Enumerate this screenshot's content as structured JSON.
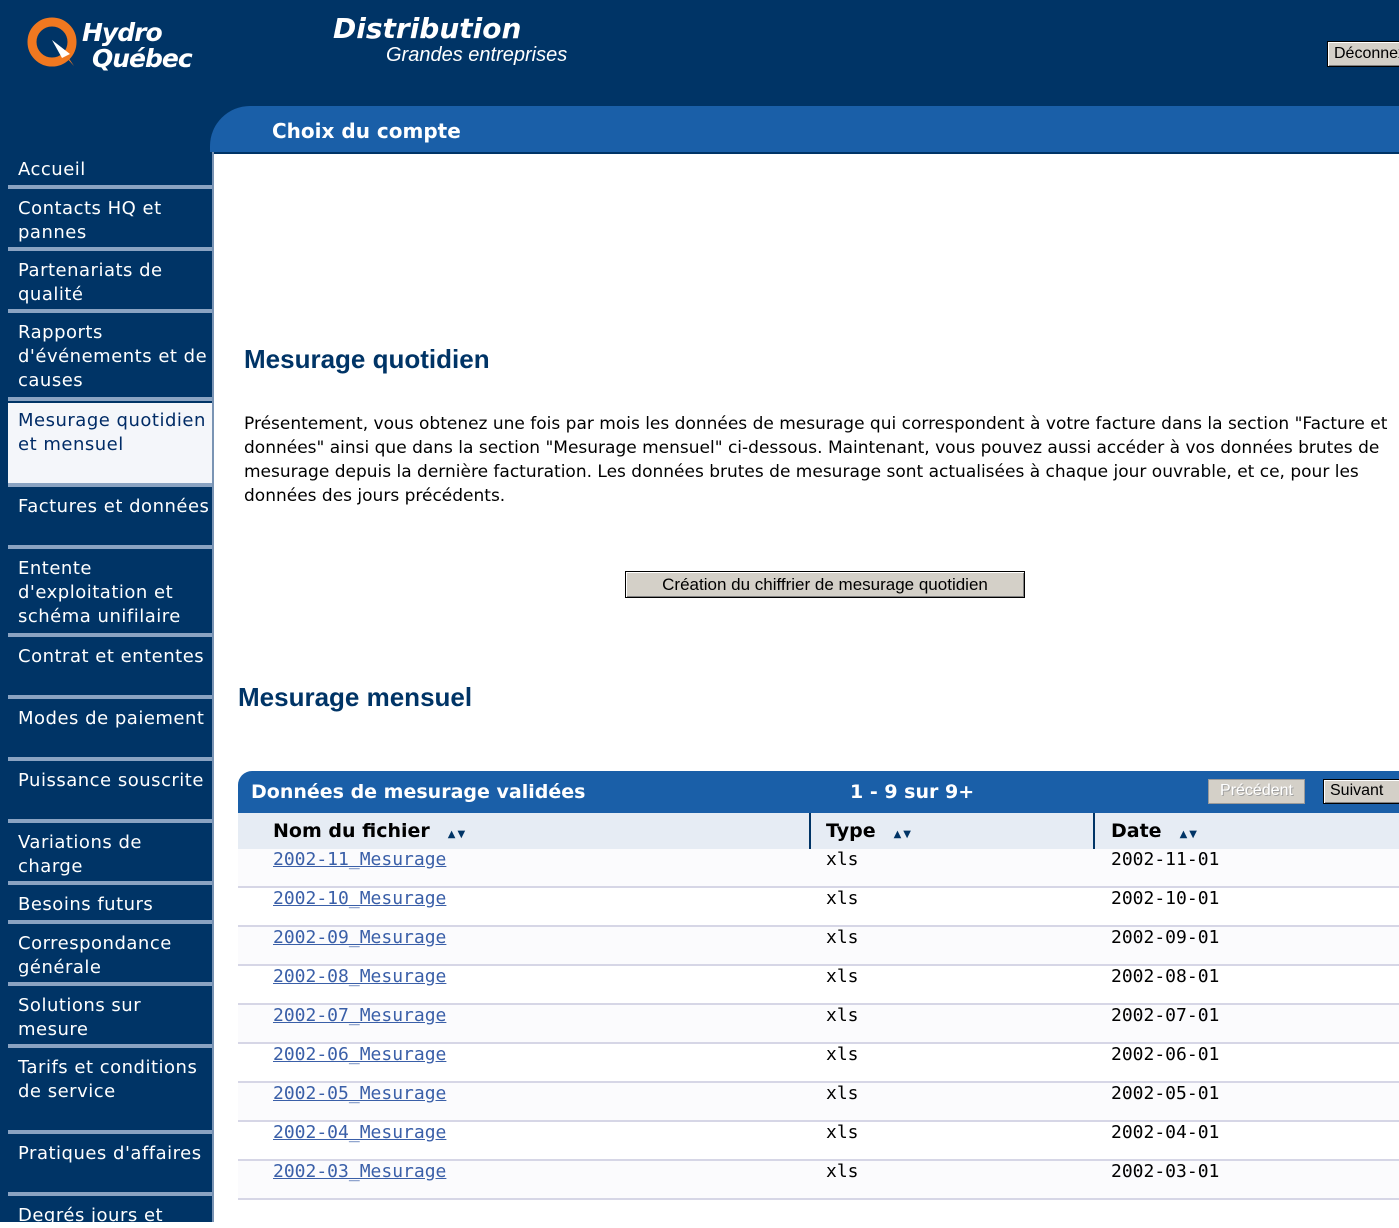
{
  "header": {
    "logo_line1": "Hydro",
    "logo_line2": "Québec",
    "title": "Distribution",
    "subtitle": "Grandes entreprises",
    "logout_label": "Déconnexion",
    "section_title": "Choix du compte"
  },
  "sidebar": {
    "items": [
      {
        "label": "Accueil"
      },
      {
        "label": "Contacts HQ et pannes"
      },
      {
        "label": "Partenariats de qualité"
      },
      {
        "label": "Rapports d'événements et de causes"
      },
      {
        "label": "Mesurage quotidien et mensuel",
        "active": true
      },
      {
        "label": "Factures et données"
      },
      {
        "label": "Entente d'exploitation et schéma unifilaire"
      },
      {
        "label": "Contrat et ententes"
      },
      {
        "label": "Modes de paiement"
      },
      {
        "label": "Puissance souscrite"
      },
      {
        "label": "Variations de charge"
      },
      {
        "label": "Besoins futurs"
      },
      {
        "label": "Correspondance générale"
      },
      {
        "label": "Solutions sur mesure"
      },
      {
        "label": "Tarifs et conditions de service"
      },
      {
        "label": "Pratiques d'affaires"
      },
      {
        "label": "Degrés jours et"
      }
    ]
  },
  "daily": {
    "heading": "Mesurage quotidien",
    "intro": "Présentement, vous obtenez une fois par mois les données de mesurage qui correspondent à votre facture dans la section \"Facture et données\" ainsi que dans la section \"Mesurage mensuel\" ci-dessous. Maintenant, vous pouvez aussi accéder à vos données brutes de mesurage depuis la dernière facturation. Les données brutes de mesurage sont actualisées à chaque jour ouvrable, et ce, pour les données des jours précédents.",
    "create_button": "Création du chiffrier de mesurage quotidien"
  },
  "monthly": {
    "heading": "Mesurage mensuel",
    "table_title": "Données de mesurage validées",
    "range": "1 - 9 sur 9+",
    "prev_label": "Précédent",
    "next_label": "Suivant",
    "columns": [
      "Nom du fichier",
      "Type",
      "Date"
    ],
    "sort_arrows": "▲▼",
    "rows": [
      {
        "name": "2002-11_Mesurage",
        "type": "xls",
        "date": "2002-11-01"
      },
      {
        "name": "2002-10_Mesurage",
        "type": "xls",
        "date": "2002-10-01"
      },
      {
        "name": "2002-09_Mesurage",
        "type": "xls",
        "date": "2002-09-01"
      },
      {
        "name": "2002-08_Mesurage",
        "type": "xls",
        "date": "2002-08-01"
      },
      {
        "name": "2002-07_Mesurage",
        "type": "xls",
        "date": "2002-07-01"
      },
      {
        "name": "2002-06_Mesurage",
        "type": "xls",
        "date": "2002-06-01"
      },
      {
        "name": "2002-05_Mesurage",
        "type": "xls",
        "date": "2002-05-01"
      },
      {
        "name": "2002-04_Mesurage",
        "type": "xls",
        "date": "2002-04-01"
      },
      {
        "name": "2002-03_Mesurage",
        "type": "xls",
        "date": "2002-03-01"
      }
    ]
  },
  "colors": {
    "navy": "#003466",
    "accent_blue": "#1a5fa8",
    "logo_orange": "#f07820",
    "link": "#3a5fa8"
  }
}
